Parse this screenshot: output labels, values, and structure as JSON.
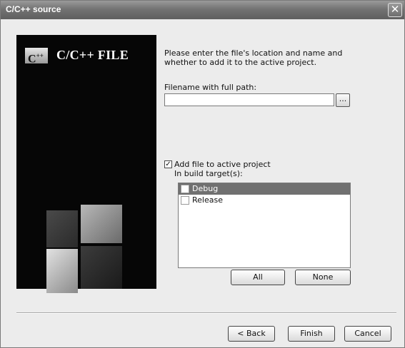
{
  "window": {
    "title": "C/C++ source",
    "close_glyph": "✕"
  },
  "banner": {
    "logo_text": "C",
    "logo_sup": "++",
    "title": "C/C++ FILE"
  },
  "form": {
    "intro": "Please enter the file's location and name and\nwhether to add it to the active project.",
    "path_label": "Filename with full path:",
    "path_value": "",
    "browse_label": "...",
    "add_checked": true,
    "add_check_glyph": "✓",
    "add_label": "Add file to active project",
    "targets_label": "In build target(s):",
    "targets": [
      {
        "label": "Debug",
        "selected": true,
        "checked": false
      },
      {
        "label": "Release",
        "selected": false,
        "checked": false
      }
    ],
    "all_label": "All",
    "none_label": "None"
  },
  "footer": {
    "back_label": "< Back",
    "finish_label": "Finish",
    "cancel_label": "Cancel"
  }
}
